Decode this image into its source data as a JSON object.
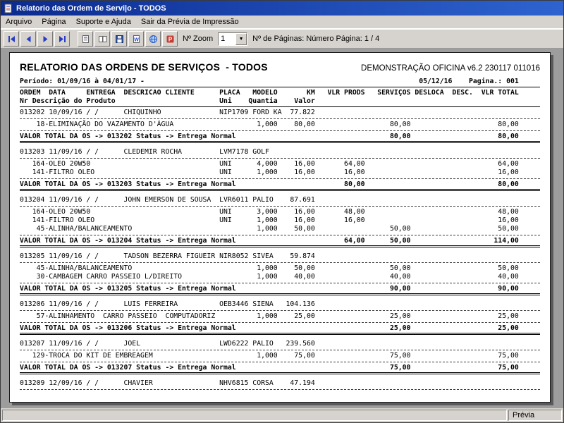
{
  "window": {
    "title": "Relatorio das Ordem de Servi|o - TODOS",
    "menu": [
      "Arquivo",
      "Página",
      "Suporte e Ajuda",
      "Sair da Prévia de Impressão"
    ],
    "toolbar": {
      "zoom_label": "Nº Zoom",
      "zoom_value": "1",
      "pages_info": "Nº de Páginas: Número Página: 1 / 4",
      "icons": [
        "first-page",
        "previous-page",
        "next-page",
        "last-page",
        "page-setup",
        "two-page-view",
        "save",
        "export-doc",
        "export-html",
        "export-pdf"
      ]
    },
    "status_right": "Prévia"
  },
  "report": {
    "title": "RELATORIO DAS ORDENS DE SERVIÇOS  - TODOS",
    "header_right": "DEMONSTRAÇÃO OFICINA v6.2 230117 011016",
    "period": "Período: 01/09/16 à 04/01/17 -",
    "print_date": "05/12/16",
    "page_label": "Pagina.: 001",
    "col_headers1": [
      "ORDEM",
      "DATA",
      "ENTREGA",
      "DESCRICAO CLIENTE",
      "PLACA",
      "MODELO",
      "KM",
      "VLR PRODS",
      "SERVIÇOS",
      "DESLOCA",
      "DESC.",
      "VLR TOTAL"
    ],
    "col_headers2": [
      "Nr Descrição do Produto",
      "Uni",
      "Quantia",
      "Valor"
    ],
    "total_prefix": "VALOR TOTAL DA OS ->",
    "status_prefix": "Status ->",
    "orders": [
      {
        "nr": "013202",
        "date": "10/09/16",
        "delivery": "/ /",
        "client": "CHIQUINHO",
        "plate": "NIP1709",
        "model": "FORD KA",
        "km": "77.822",
        "items": [
          {
            "code": "18",
            "desc": "ELIMINAÇÃO DO VAZAMENTO D'ÁGUA",
            "uni": "",
            "qty": "1,000",
            "unit_value": "80,00",
            "vlr_prods": "",
            "vlr_serv": "80,00",
            "vlr_total": "80,00"
          }
        ],
        "status": "Entrega Normal",
        "totals": {
          "vlr_prods": "",
          "vlr_serv": "80,00",
          "vlr_total": "80,00"
        }
      },
      {
        "nr": "013203",
        "date": "11/09/16",
        "delivery": "/ /",
        "client": "CLEDEMIR ROCHA",
        "plate": "LVM7178",
        "model": "GOLF",
        "km": "",
        "items": [
          {
            "code": "164",
            "desc": "OLEO 20W50",
            "uni": "UNI",
            "qty": "4,000",
            "unit_value": "16,00",
            "vlr_prods": "64,00",
            "vlr_serv": "",
            "vlr_total": "64,00"
          },
          {
            "code": "141",
            "desc": "FILTRO OLEO",
            "uni": "UNI",
            "qty": "1,000",
            "unit_value": "16,00",
            "vlr_prods": "16,00",
            "vlr_serv": "",
            "vlr_total": "16,00"
          }
        ],
        "status": "Entrega Normal",
        "totals": {
          "vlr_prods": "80,00",
          "vlr_serv": "",
          "vlr_total": "80,00"
        }
      },
      {
        "nr": "013204",
        "date": "11/09/16",
        "delivery": "/ /",
        "client": "JOHN EMERSON DE SOUSA",
        "plate": "LVR6011",
        "model": "PALIO",
        "km": "87.691",
        "items": [
          {
            "code": "164",
            "desc": "OLEO 20W50",
            "uni": "UNI",
            "qty": "3,000",
            "unit_value": "16,00",
            "vlr_prods": "48,00",
            "vlr_serv": "",
            "vlr_total": "48,00"
          },
          {
            "code": "141",
            "desc": "FILTRO OLEO",
            "uni": "UNI",
            "qty": "1,000",
            "unit_value": "16,00",
            "vlr_prods": "16,00",
            "vlr_serv": "",
            "vlr_total": "16,00"
          },
          {
            "code": "45",
            "desc": "ALINHA/BALANCEAMENTO",
            "uni": "",
            "qty": "1,000",
            "unit_value": "50,00",
            "vlr_prods": "",
            "vlr_serv": "50,00",
            "vlr_total": "50,00"
          }
        ],
        "status": "Entrega Normal",
        "totals": {
          "vlr_prods": "64,00",
          "vlr_serv": "50,00",
          "vlr_total": "114,00"
        }
      },
      {
        "nr": "013205",
        "date": "11/09/16",
        "delivery": "/ /",
        "client": "TADSON BEZERRA FIGUEIR",
        "plate": "NIR8052",
        "model": "SIVEA",
        "km": "59.874",
        "items": [
          {
            "code": "45",
            "desc": "ALINHA/BALANCEAMENTO",
            "uni": "",
            "qty": "1,000",
            "unit_value": "50,00",
            "vlr_prods": "",
            "vlr_serv": "50,00",
            "vlr_total": "50,00"
          },
          {
            "code": "30",
            "desc": "CAMBAGEM CARRO PASSEIO L/DIREITO",
            "uni": "",
            "qty": "1,000",
            "unit_value": "40,00",
            "vlr_prods": "",
            "vlr_serv": "40,00",
            "vlr_total": "40,00"
          }
        ],
        "status": "Entrega Normal",
        "totals": {
          "vlr_prods": "",
          "vlr_serv": "90,00",
          "vlr_total": "90,00"
        }
      },
      {
        "nr": "013206",
        "date": "11/09/16",
        "delivery": "/ /",
        "client": "LUIS FERREIRA",
        "plate": "OEB3446",
        "model": "SIENA",
        "km": "104.136",
        "items": [
          {
            "code": "57",
            "desc": "ALINHAMENTO  CARRO PASSEIO  COMPUTADORIZ",
            "uni": "",
            "qty": "1,000",
            "unit_value": "25,00",
            "vlr_prods": "",
            "vlr_serv": "25,00",
            "vlr_total": "25,00"
          }
        ],
        "status": "Entrega Normal",
        "totals": {
          "vlr_prods": "",
          "vlr_serv": "25,00",
          "vlr_total": "25,00"
        }
      },
      {
        "nr": "013207",
        "date": "11/09/16",
        "delivery": "/ /",
        "client": "JOEL",
        "plate": "LWD6222",
        "model": "PALIO",
        "km": "239.560",
        "items": [
          {
            "code": "129",
            "desc": "TROCA DO KIT DE EMBREAGEM",
            "uni": "",
            "qty": "1,000",
            "unit_value": "75,00",
            "vlr_prods": "",
            "vlr_serv": "75,00",
            "vlr_total": "75,00"
          }
        ],
        "status": "Entrega Normal",
        "totals": {
          "vlr_prods": "",
          "vlr_serv": "75,00",
          "vlr_total": "75,00"
        }
      },
      {
        "nr": "013209",
        "date": "12/09/16",
        "delivery": "/ /",
        "client": "CHAVIER",
        "plate": "NHV6815",
        "model": "CORSA",
        "km": "47.194",
        "items": [],
        "status": "",
        "totals": null
      }
    ]
  }
}
